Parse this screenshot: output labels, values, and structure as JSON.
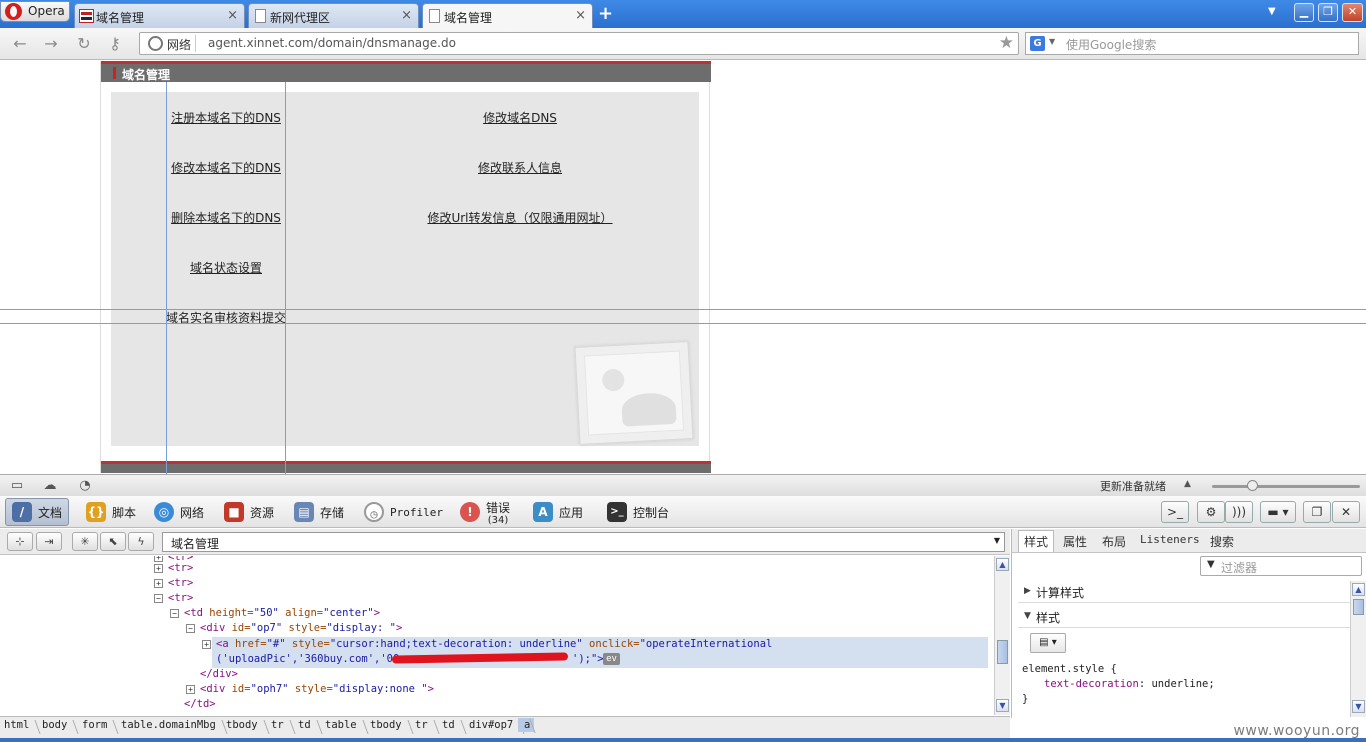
{
  "browser": {
    "menu_label": "Opera",
    "tabs": [
      {
        "title": "域名管理",
        "favicon": "xinnet-icon"
      },
      {
        "title": "新网代理区",
        "favicon": "document-icon"
      },
      {
        "title": "域名管理",
        "favicon": "document-icon"
      }
    ],
    "new_tab_symbol": "+",
    "close_symbol": "×",
    "address": {
      "badge": "网络",
      "url": "agent.xinnet.com/domain/dnsmanage.do"
    },
    "search": {
      "engine": "G",
      "placeholder": "使用Google搜索"
    }
  },
  "page": {
    "panel_title": "域名管理",
    "links_left": [
      "注册本域名下的DNS",
      "修改本域名下的DNS",
      "删除本域名下的DNS",
      "域名状态设置",
      "域名实名审核资料提交"
    ],
    "links_right": [
      "修改域名DNS",
      "修改联系人信息",
      "修改Url转发信息（仅限通用网址）"
    ]
  },
  "status": {
    "text": "更新准备就绪"
  },
  "devtools": {
    "tabs": [
      {
        "label": "文档",
        "icon": "document-icon",
        "color": "#4d6fa5"
      },
      {
        "label": "脚本",
        "icon": "script-icon",
        "color": "#e0a020"
      },
      {
        "label": "网络",
        "icon": "network-icon",
        "color": "#3a8ad8"
      },
      {
        "label": "资源",
        "icon": "resources-icon",
        "color": "#c0392b"
      },
      {
        "label": "存储",
        "icon": "storage-icon",
        "color": "#6a86b4"
      },
      {
        "label": "Profiler",
        "icon": "profiler-icon",
        "color": "#999999"
      },
      {
        "label": "错误",
        "sub": "(34)",
        "icon": "error-icon",
        "color": "#d9534f"
      },
      {
        "label": "应用",
        "icon": "apps-icon",
        "color": "#3c8dc5"
      },
      {
        "label": "控制台",
        "icon": "console-icon",
        "color": "#333333"
      }
    ],
    "selected_element": "域名管理",
    "tree": {
      "line_tr1": "<tr>",
      "line_tr2": "<tr>",
      "line_tr3": "<tr>",
      "td_tag": "<td ",
      "td_attr1": "height=",
      "td_val1": "\"50\"",
      "td_attr2": " align=",
      "td_val2": "\"center\"",
      "div_tag": "<div ",
      "div_attr1": "id=",
      "div_val1": "\"op7\"",
      "div_attr2": " style=",
      "div_val2": "\"display: \"",
      "a_tag": "<a ",
      "a_attr1": "href=",
      "a_val1": "\"#\"",
      "a_attr2": " style=",
      "a_val2": "\"cursor:hand;text-decoration: underline\"",
      "a_attr3": " onclick=",
      "a_val3": "\"operateInternational",
      "a_line2": "('uploadPic','360buy.com','00",
      "a_line2_end": "');\">",
      "ev_badge": "ev",
      "div_close": "</div>",
      "div2_tag": "<div ",
      "div2_attr1": "id=",
      "div2_val1": "\"oph7\"",
      "div2_attr2": " style=",
      "div2_val2": "\"display:none \"",
      "td_close": "</td>"
    },
    "path": [
      "html",
      "body",
      "form",
      "table.domainMbg",
      "tbody",
      "tr",
      "td",
      "table",
      "tbody",
      "tr",
      "td",
      "div#op7",
      "a"
    ],
    "style_tabs": [
      "样式",
      "属性",
      "布局",
      "Listeners",
      "搜索"
    ],
    "filter_placeholder": "过滤器",
    "sections": [
      "计算样式",
      "样式"
    ],
    "rule": {
      "selector": "element.style {",
      "property": "text-decoration",
      "value": "underline;",
      "close": "}"
    }
  },
  "watermark": "www.wooyun.org"
}
